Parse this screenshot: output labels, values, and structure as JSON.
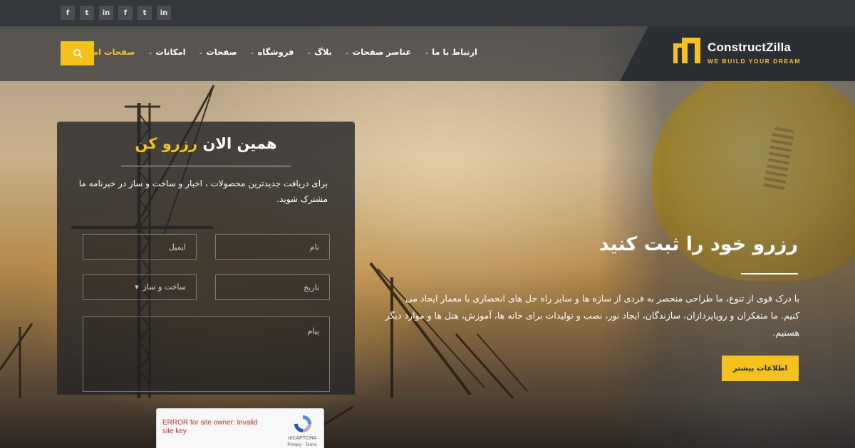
{
  "topbar": {
    "social": [
      "f",
      "t",
      "in",
      "f",
      "t",
      "in"
    ]
  },
  "brand": {
    "name": "ConstructZilla",
    "tagline": "WE BUILD YOUR DREAM"
  },
  "nav": {
    "items": [
      {
        "label": "صفحات اصلی",
        "active": true,
        "caret": true
      },
      {
        "label": "امکانات",
        "active": false,
        "caret": true
      },
      {
        "label": "صفحات",
        "active": false,
        "caret": true
      },
      {
        "label": "فروشگاه",
        "active": false,
        "caret": true
      },
      {
        "label": "بلاگ",
        "active": false,
        "caret": true
      },
      {
        "label": "عناصر صفحات",
        "active": false,
        "caret": true
      },
      {
        "label": "ارتباط با ما",
        "active": false,
        "caret": true
      }
    ],
    "search_icon": "search-icon"
  },
  "booking": {
    "title_part1": "همین الان",
    "title_part2": "رزرو کن",
    "description": "برای دریافت جدیدترین محصولات ، اخبار و ساخت و ساز در خبرنامه ما مشترک شوید.",
    "fields": {
      "name_placeholder": "نام",
      "email_placeholder": "ایمیل",
      "date_placeholder": "تاریخ",
      "service_selected": "ساخت و ساز",
      "message_placeholder": "پیام"
    },
    "recaptcha": {
      "error": "ERROR for site owner: Invalid site key",
      "brand": "reCAPTCHA",
      "links": "Privacy - Terms"
    }
  },
  "hero": {
    "title": "رزرو خود را ثبت کنید",
    "body": "با درک قوی از تنوع، ما طراحی منحصر به فردی از سازه ها و سایر راه حل های انحصاری با معمار ایجاد می کنیم. ما متفکران و رویاپردازان، سازندگان، ایجاد نور، نصب و تولیدات برای خانه ها، آموزش، هتل ها و موارد دیگر هستیم.",
    "button_label": "اطلاعات بیشتر"
  },
  "colors": {
    "accent": "#f4c21b",
    "topbar": "#34373c",
    "panel": "#232428"
  }
}
